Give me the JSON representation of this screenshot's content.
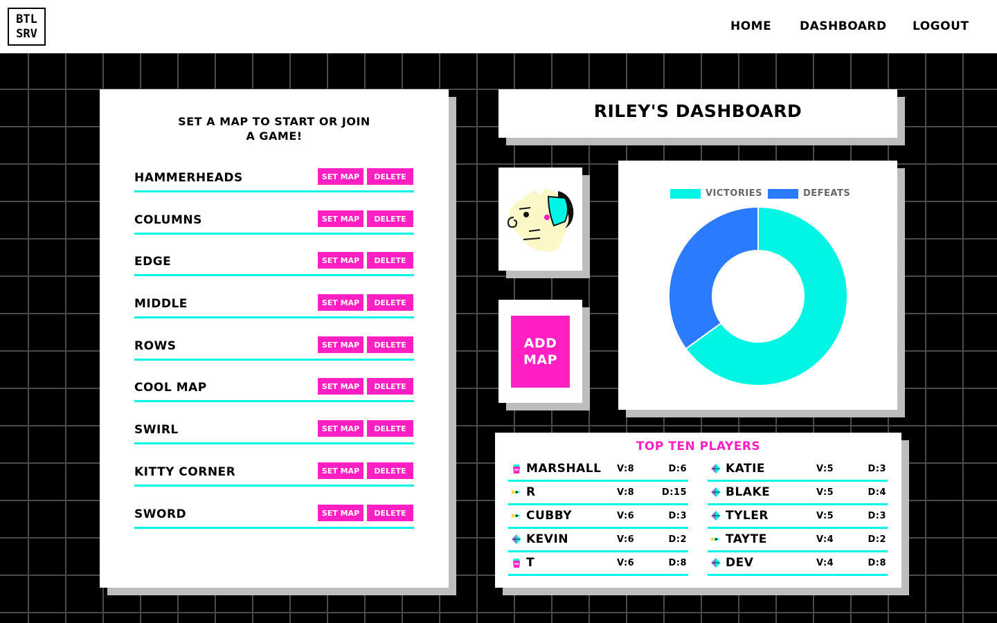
{
  "header": {
    "logo_line1": "BTL",
    "logo_line2": "SRV",
    "nav": {
      "home": "HOME",
      "dashboard": "DASHBOARD",
      "logout": "LOGOUT"
    }
  },
  "maps_panel": {
    "title_line1": "SET A MAP TO START OR JOIN",
    "title_line2": "A GAME!",
    "set_label": "SET MAP",
    "delete_label": "DELETE",
    "maps": [
      {
        "name": "HAMMERHEADS"
      },
      {
        "name": "COLUMNS"
      },
      {
        "name": "EDGE"
      },
      {
        "name": "MIDDLE"
      },
      {
        "name": "ROWS"
      },
      {
        "name": "COOL MAP"
      },
      {
        "name": "SWIRL"
      },
      {
        "name": "KITTY CORNER"
      },
      {
        "name": "SWORD"
      }
    ]
  },
  "dashboard": {
    "title": "RILEY'S DASHBOARD"
  },
  "add_map": {
    "line1": "ADD",
    "line2": "MAP"
  },
  "chart_data": {
    "type": "pie",
    "style": "doughnut",
    "labels": [
      "VICTORIES",
      "DEFEATS"
    ],
    "values": [
      65,
      35
    ],
    "colors": [
      "#00f5e4",
      "#2b7bff"
    ],
    "legend": "top"
  },
  "top_players": {
    "title": "TOP TEN PLAYERS",
    "players": [
      {
        "name": "MARSHALL",
        "v": "V:8",
        "d": "D:6",
        "icon": "pink-cup-icon"
      },
      {
        "name": "KATIE",
        "v": "V:5",
        "d": "D:3",
        "icon": "cyan-gem-icon"
      },
      {
        "name": "R",
        "v": "V:8",
        "d": "D:15",
        "icon": "rocket-icon"
      },
      {
        "name": "BLAKE",
        "v": "V:5",
        "d": "D:4",
        "icon": "cyan-gem-icon"
      },
      {
        "name": "CUBBY",
        "v": "V:6",
        "d": "D:3",
        "icon": "rocket-icon"
      },
      {
        "name": "TYLER",
        "v": "V:5",
        "d": "D:3",
        "icon": "cyan-gem-icon"
      },
      {
        "name": "KEVIN",
        "v": "V:6",
        "d": "D:2",
        "icon": "cyan-gem-icon"
      },
      {
        "name": "TAYTE",
        "v": "V:4",
        "d": "D:2",
        "icon": "rocket-icon"
      },
      {
        "name": "T",
        "v": "V:6",
        "d": "D:8",
        "icon": "pink-cup-icon"
      },
      {
        "name": "DEV",
        "v": "V:4",
        "d": "D:8",
        "icon": "cyan-gem-icon"
      }
    ]
  }
}
